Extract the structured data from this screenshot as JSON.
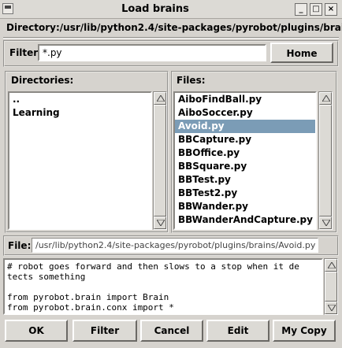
{
  "window": {
    "title": "Load brains",
    "minimize_glyph": "_",
    "maximize_glyph": "□",
    "close_glyph": "×"
  },
  "directory": {
    "label": "Directory:/usr/lib/python2.4/site-packages/pyrobot/plugins/brains"
  },
  "filter": {
    "label": "Filter:",
    "value": "*.py",
    "home_button": "Home"
  },
  "directories": {
    "label": "Directories:",
    "items": [
      "..",
      "Learning"
    ]
  },
  "files": {
    "label": "Files:",
    "items": [
      "AiboFindBall.py",
      "AiboSoccer.py",
      "Avoid.py",
      "BBCapture.py",
      "BBOffice.py",
      "BBSquare.py",
      "BBTest.py",
      "BBTest2.py",
      "BBWander.py",
      "BBWanderAndCapture.py"
    ],
    "selected": "Avoid.py"
  },
  "file": {
    "label": "File:",
    "value": "/usr/lib/python2.4/site-packages/pyrobot/plugins/brains/Avoid.py"
  },
  "preview": {
    "lines": [
      "# robot goes forward and then slows to a stop when it de",
      "tects something",
      "",
      "from pyrobot.brain import Brain",
      "from pyrobot.brain.conx import *"
    ]
  },
  "buttons": {
    "ok": "OK",
    "filter": "Filter",
    "cancel": "Cancel",
    "edit": "Edit",
    "my_copy": "My Copy"
  },
  "colors": {
    "window_bg": "#d6d3ce",
    "selection": "#7b9cb6"
  }
}
